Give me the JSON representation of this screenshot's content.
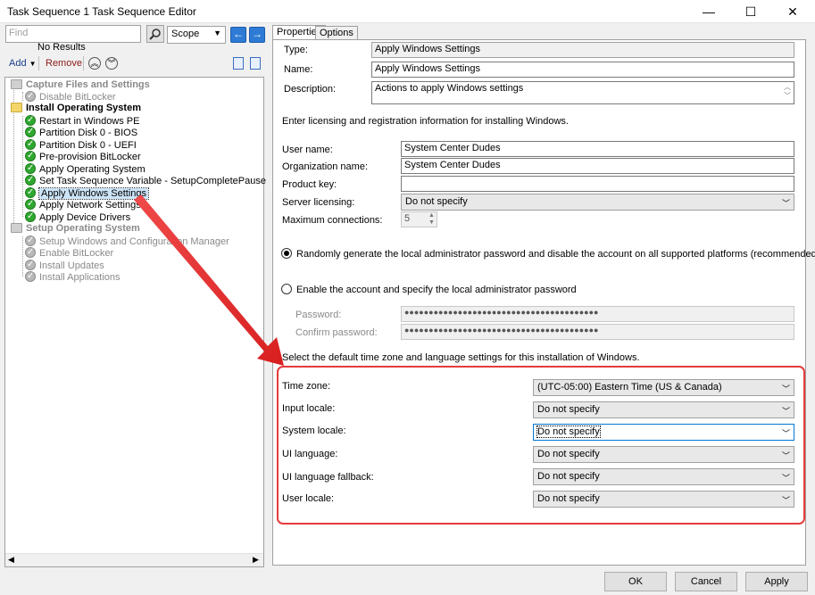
{
  "window": {
    "title": "Task Sequence 1 Task Sequence Editor",
    "minimize": "—",
    "maximize": "☐",
    "close": "✕"
  },
  "search": {
    "placeholder": "Find",
    "no_results": "No Results",
    "scope_value": "Scope"
  },
  "toolbar": {
    "add_label": "Add",
    "remove_label": "Remove"
  },
  "tree": {
    "groups": [
      {
        "name": "Capture Files and Settings",
        "enabled": false,
        "steps": [
          {
            "name": "Disable BitLocker",
            "enabled": false
          }
        ]
      },
      {
        "name": "Install Operating System",
        "enabled": true,
        "steps": [
          {
            "name": "Restart in Windows PE",
            "enabled": true
          },
          {
            "name": "Partition Disk 0 - BIOS",
            "enabled": true
          },
          {
            "name": "Partition Disk 0 - UEFI",
            "enabled": true
          },
          {
            "name": "Pre-provision BitLocker",
            "enabled": true
          },
          {
            "name": "Apply Operating System",
            "enabled": true
          },
          {
            "name": "Set Task Sequence Variable - SetupCompletePause",
            "enabled": true
          },
          {
            "name": "Apply Windows Settings",
            "enabled": true,
            "selected": true
          },
          {
            "name": "Apply Network Settings",
            "enabled": true
          },
          {
            "name": "Apply Device Drivers",
            "enabled": true
          }
        ]
      },
      {
        "name": "Setup Operating System",
        "enabled": false,
        "steps": [
          {
            "name": "Setup Windows and Configuration Manager",
            "enabled": false
          },
          {
            "name": "Enable BitLocker",
            "enabled": false
          },
          {
            "name": "Install Updates",
            "enabled": false
          },
          {
            "name": "Install Applications",
            "enabled": false
          }
        ]
      }
    ]
  },
  "tabs": [
    {
      "label": "Properties",
      "active": true
    },
    {
      "label": "Options",
      "active": false
    }
  ],
  "properties": {
    "type_label": "Type:",
    "type_value": "Apply Windows Settings",
    "name_label": "Name:",
    "name_value": "Apply Windows Settings",
    "description_label": "Description:",
    "description_value": "Actions to apply Windows settings"
  },
  "licensing": {
    "intro": "Enter licensing and registration information for installing Windows.",
    "user_name_label": "User name:",
    "user_name_value": "System Center Dudes",
    "org_name_label": "Organization name:",
    "org_name_value": "System Center Dudes",
    "product_key_label": "Product key:",
    "product_key_value": "",
    "server_licensing_label": "Server licensing:",
    "server_licensing_value": "Do not specify",
    "max_connections_label": "Maximum connections:",
    "max_connections_value": "5"
  },
  "admin": {
    "option_random": "Randomly generate the local administrator password and disable the account on all supported platforms (recommended)",
    "option_enable": "Enable the account and specify the local administrator password",
    "password_label": "Password:",
    "password_value": "●●●●●●●●●●●●●●●●●●●●●●●●●●●●●●●●●●●●●●●●",
    "confirm_label": "Confirm password:",
    "confirm_value": "●●●●●●●●●●●●●●●●●●●●●●●●●●●●●●●●●●●●●●●●"
  },
  "regional": {
    "intro": "Select the default time zone and language settings for this installation of Windows.",
    "time_zone_label": "Time zone:",
    "time_zone_value": "(UTC-05:00) Eastern Time (US & Canada)",
    "input_locale_label": "Input locale:",
    "input_locale_value": "Do not specify",
    "system_locale_label": "System locale:",
    "system_locale_value": "Do not specify",
    "ui_language_label": "UI language:",
    "ui_language_value": "Do not specify",
    "ui_fallback_label": "UI language fallback:",
    "ui_fallback_value": "Do not specify",
    "user_locale_label": "User locale:",
    "user_locale_value": "Do not specify"
  },
  "buttons": {
    "ok": "OK",
    "cancel": "Cancel",
    "apply": "Apply"
  },
  "colors": {
    "highlight": "#e63b3b",
    "accent": "#2e7bd6",
    "step_ok": "#2fa82f"
  }
}
